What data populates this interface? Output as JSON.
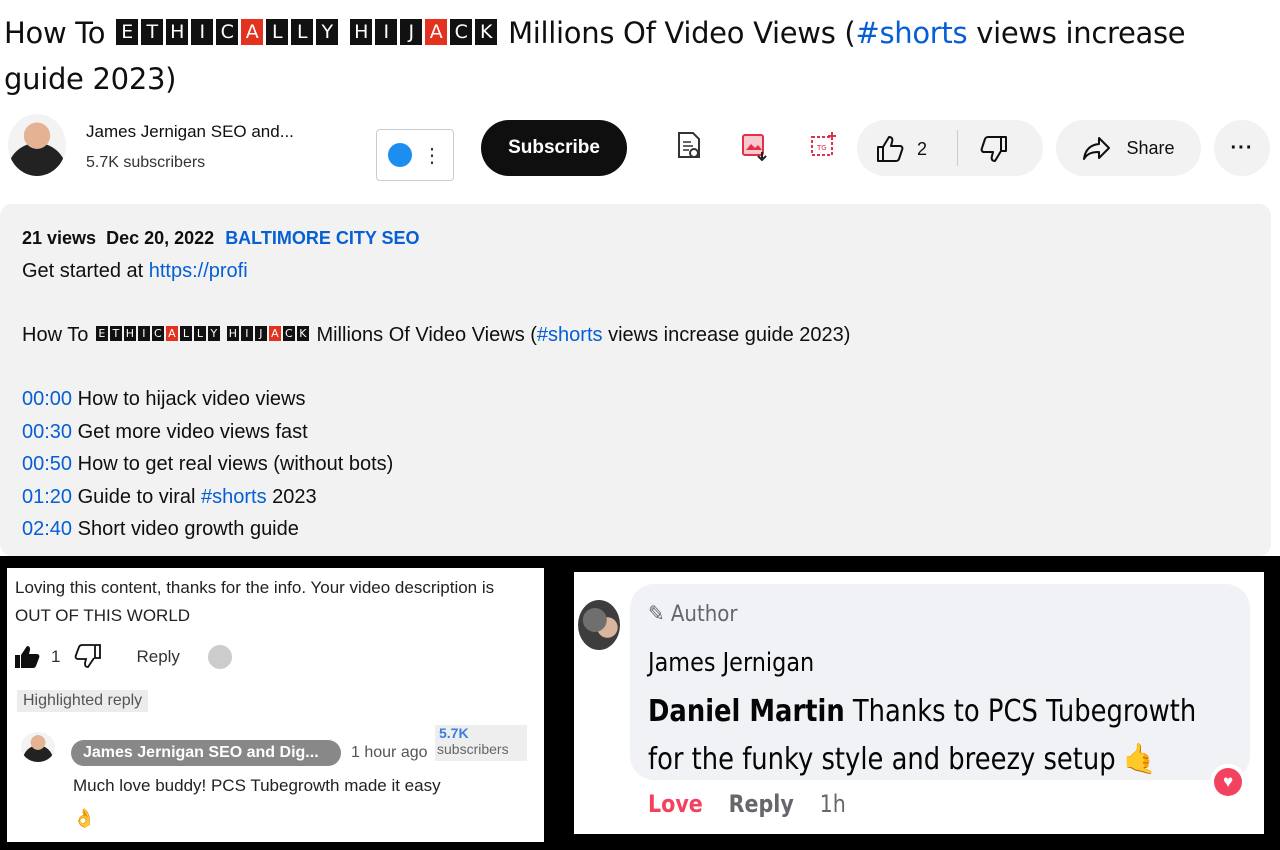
{
  "video": {
    "title_prefix": "How To",
    "title_suffix_pre": "Millions Of Video Views (",
    "title_hashtag": "#shorts",
    "title_suffix_post": " views increase guide 2023)",
    "styled_words": [
      [
        {
          "ch": "E",
          "c": "dark"
        },
        {
          "ch": "T",
          "c": "dark"
        },
        {
          "ch": "H",
          "c": "dark"
        },
        {
          "ch": "I",
          "c": "dark"
        },
        {
          "ch": "C",
          "c": "dark"
        },
        {
          "ch": "A",
          "c": "red"
        },
        {
          "ch": "L",
          "c": "dark"
        },
        {
          "ch": "L",
          "c": "dark"
        },
        {
          "ch": "Y",
          "c": "dark"
        }
      ],
      [
        {
          "ch": "H",
          "c": "dark"
        },
        {
          "ch": "I",
          "c": "dark"
        },
        {
          "ch": "J",
          "c": "dark"
        },
        {
          "ch": "A",
          "c": "red"
        },
        {
          "ch": "C",
          "c": "dark"
        },
        {
          "ch": "K",
          "c": "dark"
        }
      ]
    ]
  },
  "channel": {
    "name": "James Jernigan SEO and...",
    "subscribers": "5.7K subscribers",
    "subscribe_label": "Subscribe"
  },
  "actions": {
    "like_count": "2",
    "share_label": "Share",
    "more_label": "···"
  },
  "description": {
    "views": "21 views",
    "date": "Dec 20, 2022",
    "tag": "BALTIMORE CITY SEO",
    "started_prefix": "Get started at ",
    "started_link": "https://profi",
    "title_prefix": "How To",
    "title_suffix_pre": "Millions Of Video Views (",
    "title_hashtag": "#shorts",
    "title_suffix_post": " views increase guide 2023)",
    "chapters": [
      {
        "time": "00:00",
        "text": "How to hijack video views",
        "tag": "",
        "after": ""
      },
      {
        "time": "00:30",
        "text": "Get more video views fast",
        "tag": "",
        "after": ""
      },
      {
        "time": "00:50",
        "text": "How to get real views (without bots)",
        "tag": "",
        "after": ""
      },
      {
        "time": "01:20",
        "text": "Guide to viral ",
        "tag": "#shorts",
        "after": " 2023"
      },
      {
        "time": "02:40",
        "text": "Short video growth guide",
        "tag": "",
        "after": ""
      }
    ]
  },
  "yt_comment": {
    "text": "Loving this content, thanks for the info.  Your video description is OUT OF THIS WORLD",
    "like_count": "1",
    "reply_label": "Reply",
    "highlight_label": "Highlighted reply",
    "reply": {
      "author": "James Jernigan SEO and Dig...",
      "time": "1 hour ago",
      "subs_count": "5.7K",
      "subs_label": "subscribers",
      "text": "Much love buddy!  PCS Tubegrowth made it easy",
      "emoji": "👌"
    }
  },
  "fb_comment": {
    "badge": "Author",
    "author": "James Jernigan",
    "mention": "Daniel Martin",
    "text": " Thanks to PCS Tubegrowth for the funky style and breezy setup",
    "emoji": "🤙",
    "love_label": "Love",
    "reply_label": "Reply",
    "time": "1h"
  },
  "colors": {
    "link": "#065fd4",
    "fb_love": "#f3425f",
    "subscribe_bg": "#0f0f0f",
    "box_red": "#e3321f"
  }
}
